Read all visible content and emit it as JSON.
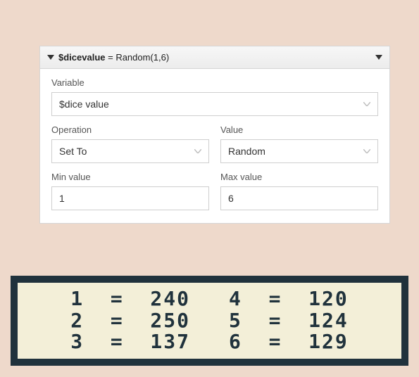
{
  "panel": {
    "title_prefix": "$dicevalue",
    "title_rest": " = Random(1,6)"
  },
  "fields": {
    "variable": {
      "label": "Variable",
      "value": "$dice value"
    },
    "operation": {
      "label": "Operation",
      "value": "Set To"
    },
    "value": {
      "label": "Value",
      "value": "Random"
    },
    "min": {
      "label": "Min value",
      "value": "1"
    },
    "max": {
      "label": "Max value",
      "value": "6"
    }
  },
  "console": {
    "left": [
      "1  =  240",
      "2  =  250",
      "3  =  137"
    ],
    "right": [
      "4  =  120",
      "5  =  124",
      "6  =  129"
    ]
  }
}
